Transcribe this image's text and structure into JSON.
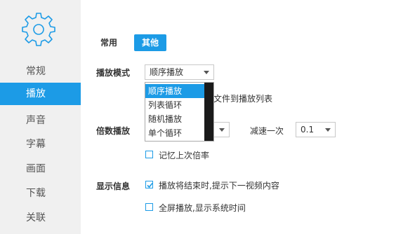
{
  "sidebar": {
    "icon": "gear-icon",
    "items": [
      {
        "label": "常规"
      },
      {
        "label": "播放"
      },
      {
        "label": "声音"
      },
      {
        "label": "字幕"
      },
      {
        "label": "画面"
      },
      {
        "label": "下载"
      },
      {
        "label": "关联"
      }
    ]
  },
  "tabs": [
    {
      "label": "常用"
    },
    {
      "label": "其他"
    }
  ],
  "playback_mode": {
    "label": "播放模式",
    "value": "顺序播放",
    "options": [
      "顺序播放",
      "列表循环",
      "随机播放",
      "单个循环"
    ]
  },
  "add_files_text": "文件到播放列表",
  "speed": {
    "label": "倍数播放",
    "decrease_label": "减速一次",
    "decrease_value": "0.1",
    "remember_label": "记忆上次倍率",
    "remember_checked": false
  },
  "display_info": {
    "label": "显示信息",
    "items": [
      {
        "label": "播放将结束时,提示下一视频内容",
        "checked": true
      },
      {
        "label": "全屏播放,显示系统时间",
        "checked": false
      }
    ]
  },
  "colors": {
    "accent": "#1c9be6",
    "sidebar_bg": "#f0f0f0"
  }
}
